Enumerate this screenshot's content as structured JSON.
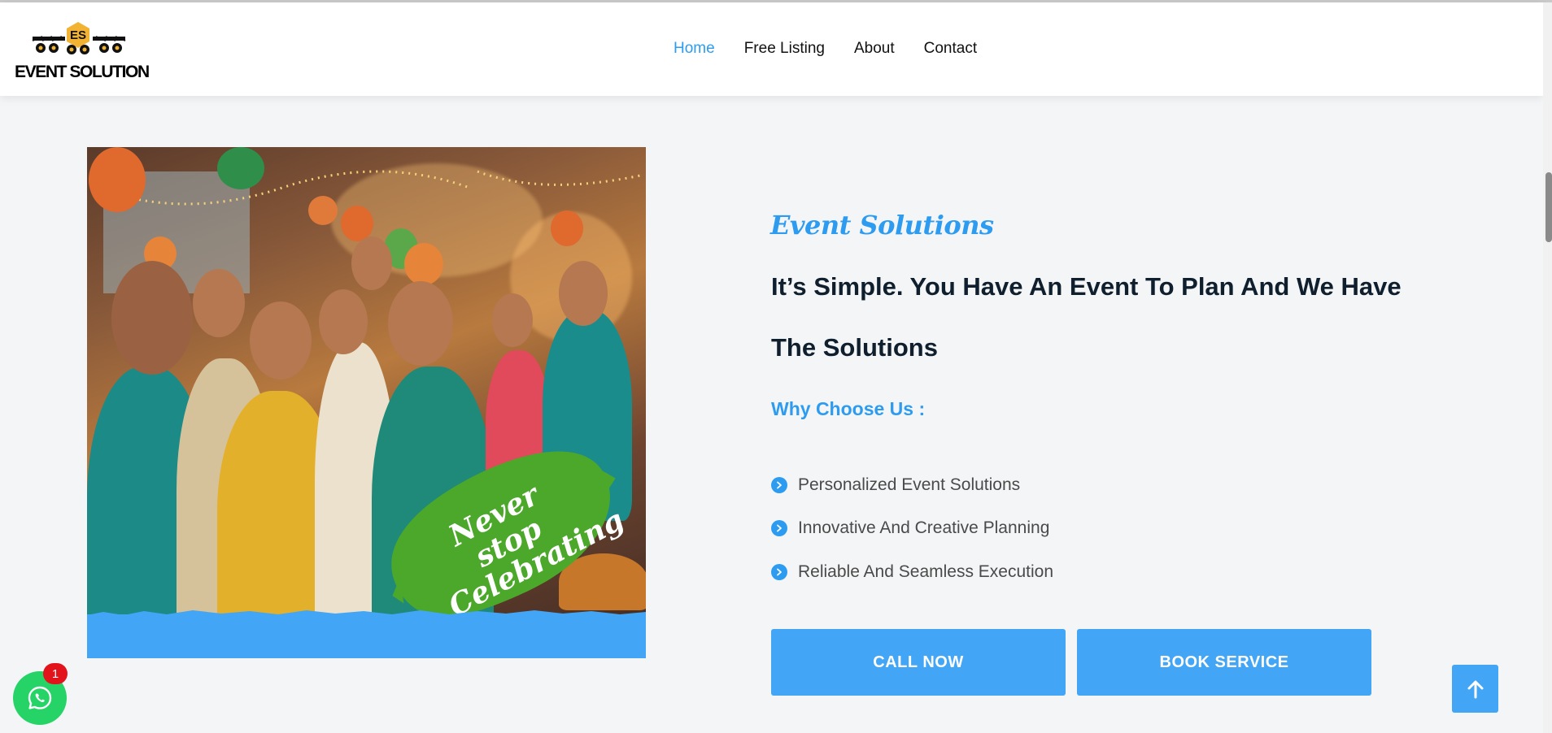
{
  "header": {
    "logo_badge": "ES",
    "logo_text": "EVENT SOLUTION",
    "nav": [
      {
        "label": "Home",
        "active": true
      },
      {
        "label": "Free Listing",
        "active": false
      },
      {
        "label": "About",
        "active": false
      },
      {
        "label": "Contact",
        "active": false
      }
    ]
  },
  "hero": {
    "image_overlay_text_line1": "Never stop",
    "image_overlay_text_line2": "Celebrating",
    "script_title": "Event Solutions",
    "headline": "It’s Simple. You Have An Event To Plan And We Have The Solutions",
    "why_title": "Why Choose Us :",
    "features": [
      "Personalized Event Solutions",
      "Innovative And Creative Planning",
      "Reliable And Seamless Execution"
    ],
    "call_label": "CALL NOW",
    "book_label": "BOOK SERVICE"
  },
  "whatsapp": {
    "badge_count": "1"
  },
  "icons": {
    "feature": "chevron-right-circle-icon",
    "to_top": "arrow-up-icon",
    "whatsapp": "whatsapp-icon"
  },
  "colors": {
    "accent": "#2d9cf0",
    "button": "#42a5f5",
    "splash_green": "#4ca82a",
    "whatsapp_green": "#25d366",
    "badge_red": "#e3131b"
  }
}
